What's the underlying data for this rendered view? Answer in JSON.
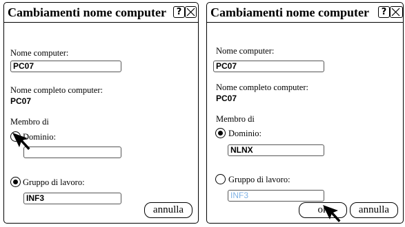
{
  "dialog_left": {
    "title": "Cambiamenti nome computer",
    "help_glyph": "?",
    "computer_name_label": "Nome computer:",
    "computer_name_value": "PC07",
    "full_name_label": "Nome completo computer:",
    "full_name_value": "PC07",
    "member_of_label": "Membro di",
    "domain_label": "Dominio:",
    "domain_value": "",
    "domain_selected": false,
    "workgroup_label": "Gruppo di lavoro:",
    "workgroup_value": "INF3",
    "workgroup_selected": true,
    "cancel_label": "annulla"
  },
  "dialog_right": {
    "title": "Cambiamenti nome computer",
    "help_glyph": "?",
    "computer_name_label": "Nome computer:",
    "computer_name_value": "PC07",
    "full_name_label": "Nome completo computer:",
    "full_name_value": "PC07",
    "member_of_label": "Membro di",
    "domain_label": "Dominio:",
    "domain_value": "NLNX",
    "domain_selected": true,
    "workgroup_label": "Gruppo di lavoro:",
    "workgroup_value": "INF3",
    "workgroup_selected": false,
    "ok_label": "ok",
    "cancel_label": "annulla"
  },
  "icons": {
    "help": "question-mark-icon",
    "close": "close-x-icon",
    "pointer": "mouse-pointer-icon"
  }
}
